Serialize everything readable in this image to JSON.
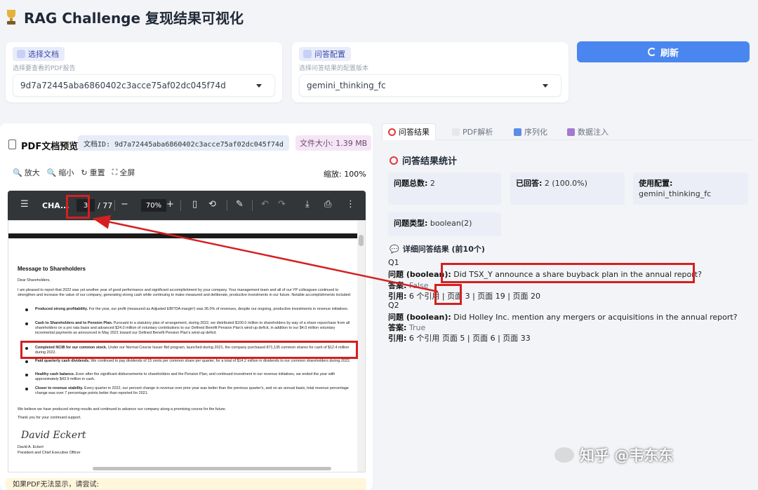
{
  "header": {
    "title": "RAG Challenge 复现结果可视化"
  },
  "doc_select": {
    "label": "选择文档",
    "hint": "选择要查看的PDF报告",
    "value": "9d7a72445aba6860402c3acce75af02dc045f74d"
  },
  "config_select": {
    "label": "问答配置",
    "hint": "选择问答结果的配置版本",
    "value": "gemini_thinking_fc"
  },
  "refresh_label": "刷新",
  "preview": {
    "title": "PDF文档预览",
    "doc_id_badge": "文档ID: 9d7a72445aba6860402c3acce75af02dc045f74d",
    "size_badge": "文件大小: 1.39 MB",
    "zoom_in": "放大",
    "zoom_out": "缩小",
    "reset": "重置",
    "fullscreen": "全屏",
    "zoom_level": "缩放: 100%"
  },
  "pdf_viewer": {
    "file_short": "CHA...",
    "page_current": "3",
    "page_total": "/ 77",
    "zoom": "70%",
    "doc_heading": "Message to Shareholders",
    "salutation": "Dear Shareholders,",
    "intro": "I am pleased to report that 2022 was yet another year of good performance and significant accomplishment by your company. Your management team and all of our YP colleagues continued to strengthen and increase the value of our company, generating strong cash while continuing to make measured and deliberate, productive investments in our future. Notable accomplishments included:",
    "bullets": [
      {
        "head": "Produced strong profitability.",
        "body": " For the year, our profit (measured as Adjusted EBITDA margin¹) was 36.0% of revenues, despite our ongoing, productive investments in revenue initiatives."
      },
      {
        "head": "Cash to Shareholders and to Pension Plan.",
        "body": " Pursuant to a statutory plan of arrangement, during 2022, we distributed $100.0 million to shareholders by way of a share repurchase from all shareholders on a pro rata basis and advanced $24.0 million of voluntary contributions to our Defined Benefit Pension Plan's wind-up deficit, in addition to our $4.0 million voluntary incremental payments as announced in May 2021 toward our Defined Benefit Pension Plan's wind-up deficit."
      },
      {
        "head": "Completed NCIB for our common stock.",
        "body": " Under our Normal Course Issuer Bid program, launched during 2021, the company purchased 871,135 common shares for cash of $12.4 million during 2022."
      },
      {
        "head": "Paid quarterly cash dividends.",
        "body": " We continued to pay dividends of 15 cents per common share per quarter, for a total of $14.2 million in dividends to our common shareholders during 2022."
      },
      {
        "head": "Healthy cash balance.",
        "body": " Even after the significant disbursements to shareholders and the Pension Plan, and continued investment in our revenue initiatives, we ended the year with approximately $43.9 million in cash."
      },
      {
        "head": "Closer to revenue stability.",
        "body": " Every quarter in 2022, our percent change in revenue over prior year was better than the previous quarter's, and on an annual basis, total revenue percentage change was over 7 percentage points better than reported for 2021."
      }
    ],
    "closing_1": "We believe we have produced strong results and continued to advance our company along a promising course for the future.",
    "closing_2": "Thank you for your continued support.",
    "signature": "David Eckert",
    "signer_name": "David A. Eckert",
    "signer_title": "President and Chief Executive Officer"
  },
  "hint_bar": "如果PDF无法显示，请尝试:",
  "tabs": [
    {
      "label": "问答结果"
    },
    {
      "label": "PDF解析"
    },
    {
      "label": "序列化"
    },
    {
      "label": "数据注入"
    }
  ],
  "stats": {
    "title": "问答结果统计",
    "total_label": "问题总数:",
    "total_value": "2",
    "answered_label": "已回答:",
    "answered_value": "2 (100.0%)",
    "config_label": "使用配置:",
    "config_value": "gemini_thinking_fc",
    "type_label": "问题类型:",
    "type_value": "boolean(2)"
  },
  "details": {
    "title": "详细问答结果 (前10个)",
    "items": [
      {
        "qnum": "Q1",
        "q_label": "问题 (boolean):",
        "q_text": "Did TSX_Y announce a share buyback plan in the annual report?",
        "a_label": "答案:",
        "a_value": "False",
        "ref_label": "引用:",
        "ref_count": "6 个引用",
        "ref_p1": "页面 3",
        "ref_rest": " | 页面 19 | 页面 20"
      },
      {
        "qnum": "Q2",
        "q_label": "问题 (boolean):",
        "q_text": "Did Holley Inc. mention any mergers or acquisitions in the annual report?",
        "a_label": "答案:",
        "a_value": "True",
        "ref_label": "引用:",
        "ref_count": "6 个引用",
        "ref_p1": "页面 5",
        "ref_rest": " | 页面 6 | 页面 33"
      }
    ]
  },
  "watermark": "知乎 @韦东东",
  "colors": {
    "accent": "#4a86f0",
    "annotation": "#d42020",
    "toolbar": "#323639"
  },
  "icons": [
    "trophy-icon",
    "document-icon",
    "settings-icon",
    "refresh-icon",
    "zoom-in-icon",
    "zoom-out-icon",
    "reset-icon",
    "fullscreen-icon",
    "menu-icon",
    "download-icon",
    "print-icon",
    "more-icon",
    "target-icon",
    "chat-icon"
  ]
}
